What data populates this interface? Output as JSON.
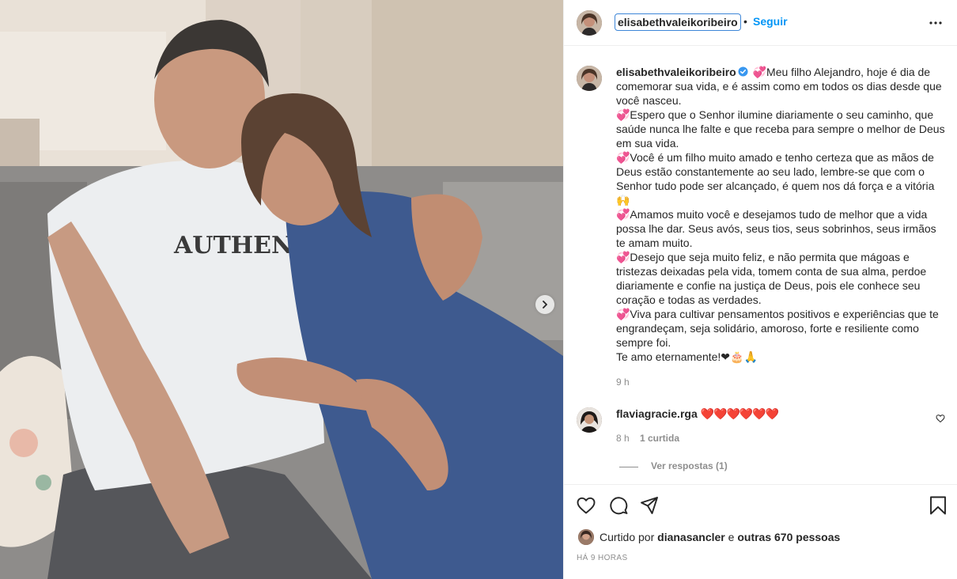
{
  "header": {
    "username": "elisabethvaleikoribeiro",
    "separator": "•",
    "follow_label": "Seguir",
    "more_icon": "more-horizontal-icon"
  },
  "caption": {
    "username": "elisabethvaleikoribeiro",
    "verified_icon": "verified-badge-icon",
    "lines": [
      "💞Meu filho Alejandro, hoje é dia de comemorar sua vida, e é assim como em todos os dias desde que você nasceu.",
      "💞Espero que o Senhor ilumine diariamente o seu caminho, que saúde nunca lhe falte e que receba para sempre o melhor de Deus em sua vida.",
      "💞Você é um filho muito amado e tenho certeza que as mãos de Deus estão constantemente ao seu lado, lembre-se que com o Senhor tudo pode ser alcançado, é quem nos dá força e a vitória 🙌",
      "💞Amamos muito você e desejamos tudo de melhor que a vida possa lhe dar. Seus avós, seus tios, seus sobrinhos, seus irmãos te amam muito.",
      "💞Desejo que seja muito feliz, e não permita que mágoas e tristezas deixadas pela vida, tomem conta de sua alma, perdoe diariamente e confie na justiça de Deus, pois ele conhece seu coração e todas as verdades.",
      "💞Viva para cultivar pensamentos positivos e experiências que te engrandeçam, seja solidário, amoroso, forte e resiliente como sempre foi.",
      "Te amo eternamente!❤🎂🙏"
    ],
    "time": "9 h"
  },
  "comment": {
    "username": "flaviagracie.rga",
    "text": "❤️❤️❤️❤️❤️❤️",
    "time": "8 h",
    "likes": "1 curtida",
    "replies": "Ver respostas (1)"
  },
  "actions": {
    "liked_prefix": "Curtido por",
    "liked_user": "dianasancler",
    "liked_and": "e",
    "liked_others": "outras 670 pessoas",
    "time_ago": "HÁ 9 HORAS"
  },
  "colors": {
    "link_blue": "#0095f6",
    "secondary_text": "#8e8e8e",
    "border": "#efefef",
    "heart_red": "#e0245e"
  }
}
